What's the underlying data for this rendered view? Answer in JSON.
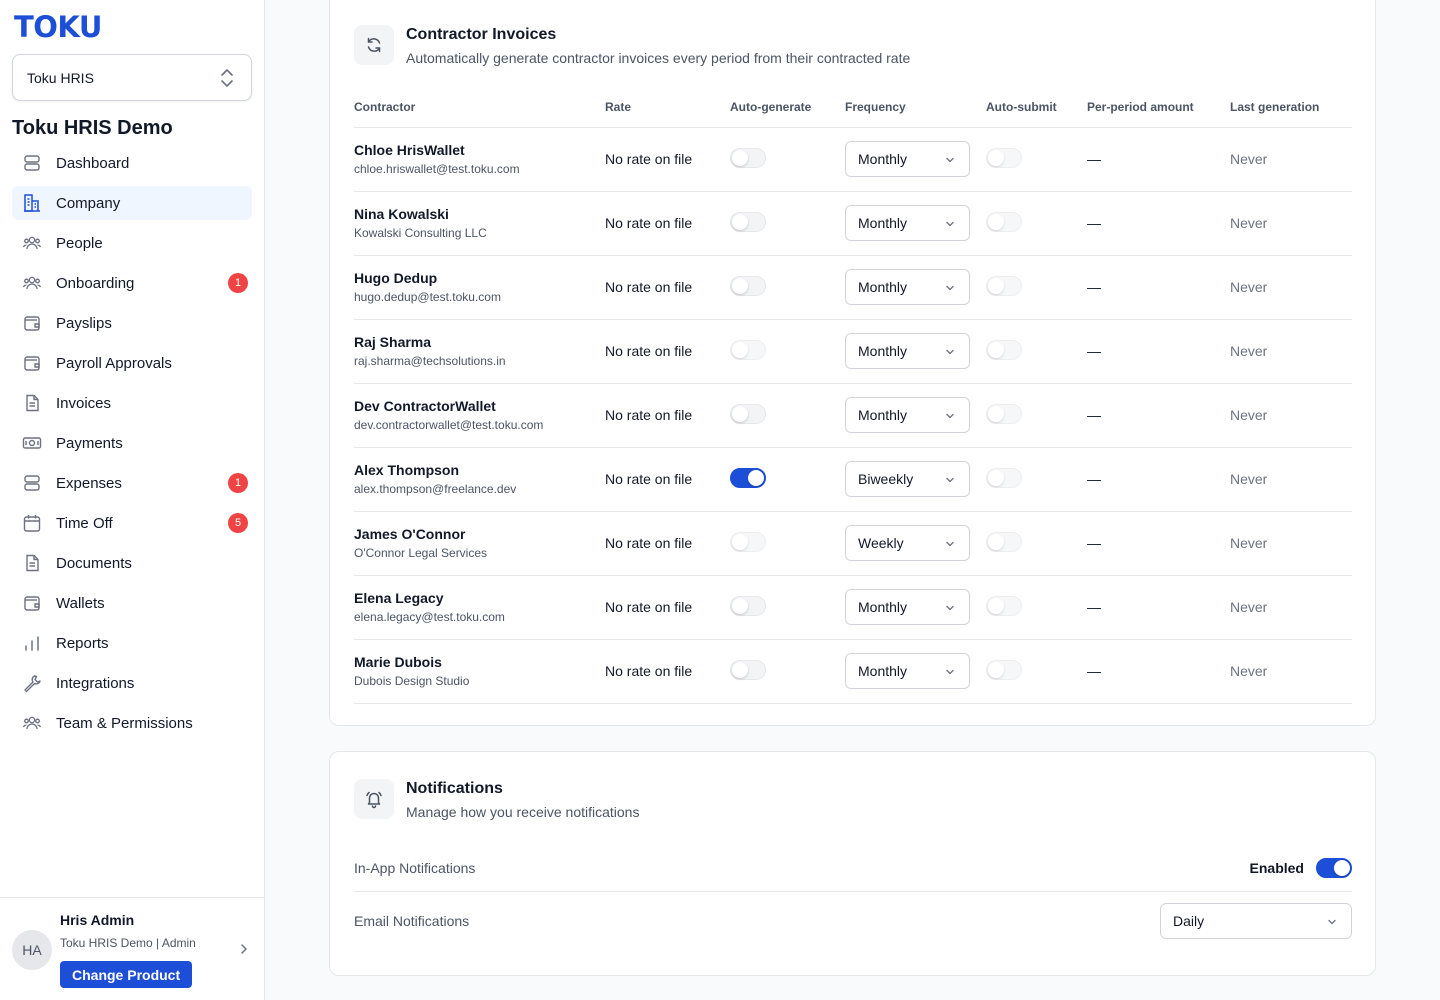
{
  "sidebar": {
    "logo": "TOKU",
    "product_switcher": "Toku HRIS",
    "org_title": "Toku HRIS Demo",
    "items": [
      {
        "label": "Dashboard",
        "icon": "stack-icon",
        "badge": null,
        "active": false
      },
      {
        "label": "Company",
        "icon": "building-icon",
        "badge": null,
        "active": true
      },
      {
        "label": "People",
        "icon": "people-icon",
        "badge": null,
        "active": false
      },
      {
        "label": "Onboarding",
        "icon": "people-icon",
        "badge": "1",
        "active": false
      },
      {
        "label": "Payslips",
        "icon": "wallet-icon",
        "badge": null,
        "active": false
      },
      {
        "label": "Payroll Approvals",
        "icon": "wallet-icon",
        "badge": null,
        "active": false
      },
      {
        "label": "Invoices",
        "icon": "document-icon",
        "badge": null,
        "active": false
      },
      {
        "label": "Payments",
        "icon": "banknote-icon",
        "badge": null,
        "active": false
      },
      {
        "label": "Expenses",
        "icon": "stack-icon",
        "badge": "1",
        "active": false
      },
      {
        "label": "Time Off",
        "icon": "calendar-icon",
        "badge": "5",
        "active": false
      },
      {
        "label": "Documents",
        "icon": "document-icon",
        "badge": null,
        "active": false
      },
      {
        "label": "Wallets",
        "icon": "wallet-icon",
        "badge": null,
        "active": false
      },
      {
        "label": "Reports",
        "icon": "bar-chart-icon",
        "badge": null,
        "active": false
      },
      {
        "label": "Integrations",
        "icon": "wrench-icon",
        "badge": null,
        "active": false
      },
      {
        "label": "Team & Permissions",
        "icon": "people-icon",
        "badge": null,
        "active": false
      }
    ],
    "user": {
      "initials": "HA",
      "name": "Hris Admin",
      "meta": "Toku HRIS Demo | Admin",
      "change_product_label": "Change Product"
    }
  },
  "contractor_invoices": {
    "title": "Contractor Invoices",
    "subtitle": "Automatically generate contractor invoices every period from their contracted rate",
    "columns": [
      "Contractor",
      "Rate",
      "Auto-generate",
      "Frequency",
      "Auto-submit",
      "Per-period amount",
      "Last generation"
    ],
    "rows": [
      {
        "name": "Chloe HrisWallet",
        "sub": "chloe.hriswallet@test.toku.com",
        "rate": "No rate on file",
        "auto_generate": "off",
        "frequency": "Monthly",
        "auto_submit": "off",
        "amount": "—",
        "last": "Never"
      },
      {
        "name": "Nina Kowalski",
        "sub": "Kowalski Consulting LLC",
        "rate": "No rate on file",
        "auto_generate": "off",
        "frequency": "Monthly",
        "auto_submit": "off",
        "amount": "—",
        "last": "Never"
      },
      {
        "name": "Hugo Dedup",
        "sub": "hugo.dedup@test.toku.com",
        "rate": "No rate on file",
        "auto_generate": "off",
        "frequency": "Monthly",
        "auto_submit": "off",
        "amount": "—",
        "last": "Never"
      },
      {
        "name": "Raj Sharma",
        "sub": "raj.sharma@techsolutions.in",
        "rate": "No rate on file",
        "auto_generate": "disabled",
        "frequency": "Monthly",
        "auto_submit": "off",
        "amount": "—",
        "last": "Never"
      },
      {
        "name": "Dev ContractorWallet",
        "sub": "dev.contractorwallet@test.toku.com",
        "rate": "No rate on file",
        "auto_generate": "off",
        "frequency": "Monthly",
        "auto_submit": "off",
        "amount": "—",
        "last": "Never"
      },
      {
        "name": "Alex Thompson",
        "sub": "alex.thompson@freelance.dev",
        "rate": "No rate on file",
        "auto_generate": "on",
        "frequency": "Biweekly",
        "auto_submit": "off",
        "amount": "—",
        "last": "Never"
      },
      {
        "name": "James O'Connor",
        "sub": "O'Connor Legal Services",
        "rate": "No rate on file",
        "auto_generate": "disabled",
        "frequency": "Weekly",
        "auto_submit": "off",
        "amount": "—",
        "last": "Never"
      },
      {
        "name": "Elena Legacy",
        "sub": "elena.legacy@test.toku.com",
        "rate": "No rate on file",
        "auto_generate": "off",
        "frequency": "Monthly",
        "auto_submit": "off",
        "amount": "—",
        "last": "Never"
      },
      {
        "name": "Marie Dubois",
        "sub": "Dubois Design Studio",
        "rate": "No rate on file",
        "auto_generate": "off",
        "frequency": "Monthly",
        "auto_submit": "off",
        "amount": "—",
        "last": "Never"
      }
    ]
  },
  "notifications": {
    "title": "Notifications",
    "subtitle": "Manage how you receive notifications",
    "in_app_label": "In-App Notifications",
    "in_app_status": "Enabled",
    "in_app_enabled": true,
    "email_label": "Email Notifications",
    "email_frequency": "Daily"
  },
  "colors": {
    "accent": "#1d4ed8",
    "active_nav_bg": "#eff6ff",
    "badge": "#ef4444"
  }
}
